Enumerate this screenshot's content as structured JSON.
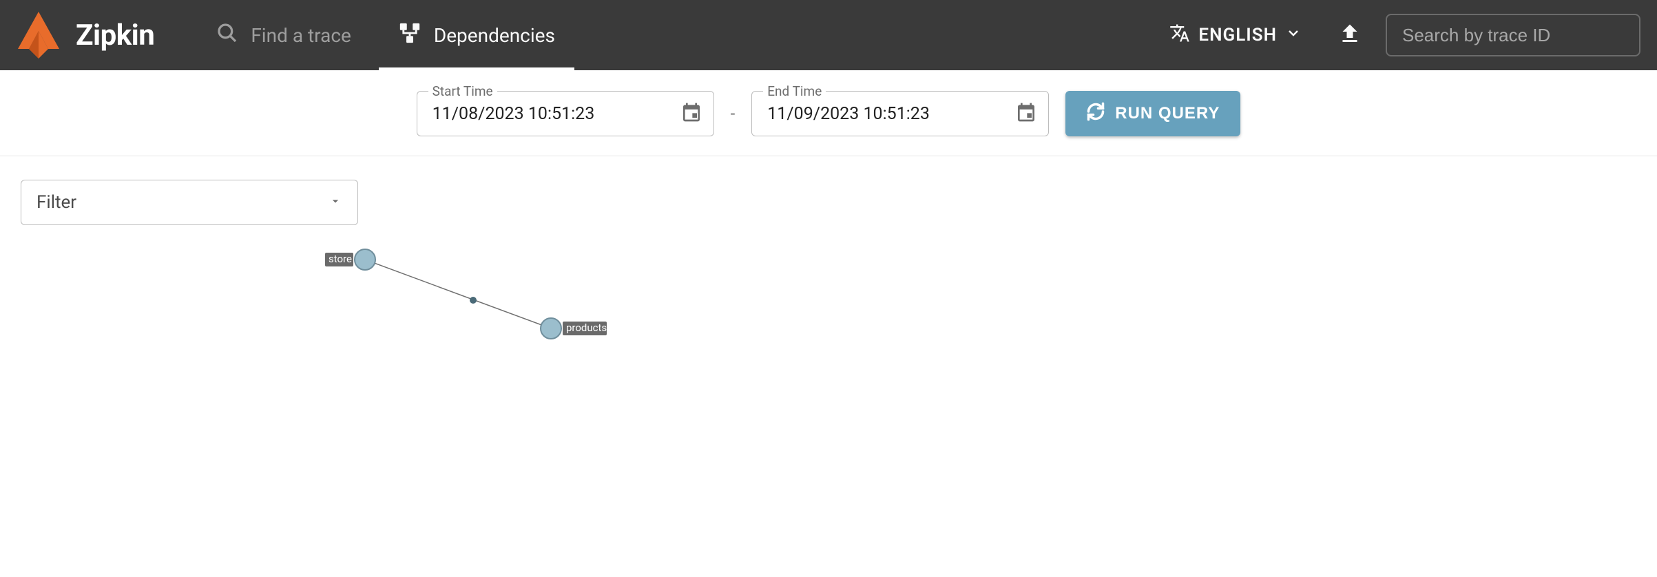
{
  "header": {
    "brand": "Zipkin",
    "nav": {
      "find_trace_label": "Find a trace",
      "dependencies_label": "Dependencies"
    },
    "language": "ENGLISH",
    "search_placeholder": "Search by trace ID"
  },
  "timebar": {
    "start": {
      "label": "Start Time",
      "value": "11/08/2023 10:51:23"
    },
    "end": {
      "label": "End Time",
      "value": "11/09/2023 10:51:23"
    },
    "separator": "-",
    "run_label": "RUN QUERY"
  },
  "filter": {
    "placeholder": "Filter"
  },
  "graph": {
    "nodes": [
      {
        "id": "store",
        "label": "store"
      },
      {
        "id": "products",
        "label": "products"
      }
    ],
    "edges": [
      {
        "from": "store",
        "to": "products"
      }
    ]
  }
}
